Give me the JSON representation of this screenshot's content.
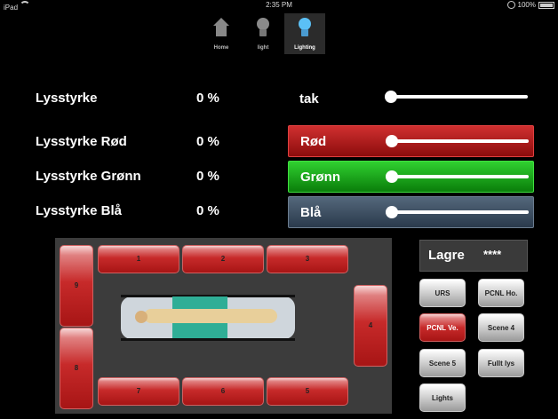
{
  "status_bar": {
    "device": "iPad",
    "time": "2:35 PM",
    "battery": "100%"
  },
  "tabs": [
    {
      "label": "Home",
      "icon": "house-icon",
      "active": false
    },
    {
      "label": "light",
      "icon": "bulb-icon",
      "active": false
    },
    {
      "label": "Lighting",
      "icon": "bulb-icon",
      "active": true
    }
  ],
  "rows": [
    {
      "label": "Lysstyrke",
      "value": "0 %",
      "channel": "tak",
      "level": 0
    },
    {
      "label": "Lysstyrke Rød",
      "value": "0 %",
      "channel": "Rød",
      "level": 0
    },
    {
      "label": "Lysstyrke Grønn",
      "value": "0 %",
      "channel": "Grønn",
      "level": 0
    },
    {
      "label": "Lysstyrke Blå",
      "value": "0 %",
      "channel": "Blå",
      "level": 0
    }
  ],
  "room_lights": [
    "1",
    "2",
    "3",
    "4",
    "5",
    "6",
    "7",
    "8",
    "9"
  ],
  "lagre": {
    "title": "Lagre",
    "code": "****"
  },
  "scenes": [
    {
      "label": "URS",
      "active": false
    },
    {
      "label": "PCNL Ho.",
      "active": false
    },
    {
      "label": "PCNL Ve.",
      "active": true
    },
    {
      "label": "Scene 4",
      "active": false
    },
    {
      "label": "Scene 5",
      "active": false
    },
    {
      "label": "Fullt lys",
      "active": false
    },
    {
      "label": "Lights",
      "active": false
    }
  ],
  "colors": {
    "red": "#c01a1a",
    "green": "#1fa81f",
    "blue": "#3e4f62",
    "panel": "#3c3c3c"
  }
}
